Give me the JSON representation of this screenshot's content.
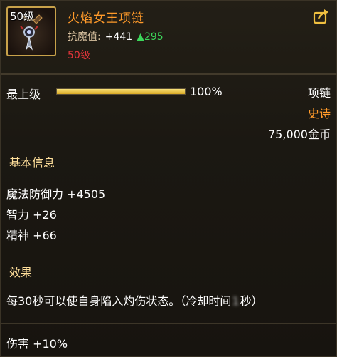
{
  "item": {
    "level_badge": "50级",
    "name": "火焰女王项链",
    "stat_label": "抗魔值:",
    "stat_value": "+441",
    "stat_increase": "▲295",
    "required_level": "50级"
  },
  "upgrade": {
    "label": "最上级",
    "percent_text": "100%",
    "progress": 1.0
  },
  "meta": {
    "type": "项链",
    "rarity": "史诗",
    "price": "75,000金币"
  },
  "basic_info": {
    "title": "基本信息",
    "attributes": [
      "魔法防御力 +4505",
      "智力 +26",
      "精神 +66"
    ]
  },
  "effect": {
    "title": "效果",
    "description_prefix": "每30秒可以使自身陷入灼伤状态。（冷却时间",
    "description_obscured": "1",
    "description_suffix": "秒）",
    "damage": "伤害 +10%"
  },
  "colors": {
    "name": "#ff9a2a",
    "rarity": "#ff9a2a",
    "stat_increase": "#3cd65a",
    "required_level": "#e4343a",
    "section_title": "#ffdf9a",
    "frame": "#c8a24a"
  },
  "icons": {
    "item": "necklace-icon",
    "share": "share-arrow-icon"
  }
}
